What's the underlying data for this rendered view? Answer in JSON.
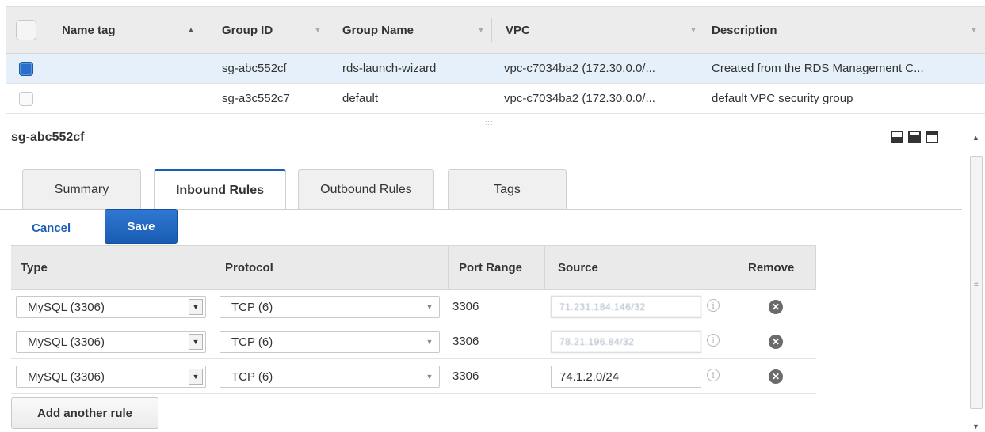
{
  "sg_table": {
    "columns": [
      "Name tag",
      "Group ID",
      "Group Name",
      "VPC",
      "Description"
    ],
    "rows": [
      {
        "selected": true,
        "name_tag": "",
        "group_id": "sg-abc552cf",
        "group_name": "rds-launch-wizard",
        "vpc": "vpc-c7034ba2 (172.30.0.0/...",
        "description": "Created from the RDS Management C..."
      },
      {
        "selected": false,
        "name_tag": "",
        "group_id": "sg-a3c552c7",
        "group_name": "default",
        "vpc": "vpc-c7034ba2 (172.30.0.0/...",
        "description": "default VPC security group"
      }
    ]
  },
  "detail": {
    "title": "sg-abc552cf",
    "tabs": [
      "Summary",
      "Inbound Rules",
      "Outbound Rules",
      "Tags"
    ],
    "active_tab": "Inbound Rules",
    "cancel_label": "Cancel",
    "save_label": "Save",
    "rules_columns": [
      "Type",
      "Protocol",
      "Port Range",
      "Source",
      "Remove"
    ],
    "rules": [
      {
        "type": "MySQL (3306)",
        "protocol": "TCP (6)",
        "port_range": "3306",
        "source": "71.231.184.146/32",
        "source_obscured": true
      },
      {
        "type": "MySQL (3306)",
        "protocol": "TCP (6)",
        "port_range": "3306",
        "source": "78.21.196.84/32",
        "source_obscured": true
      },
      {
        "type": "MySQL (3306)",
        "protocol": "TCP (6)",
        "port_range": "3306",
        "source": "74.1.2.0/24",
        "source_obscured": false
      }
    ],
    "add_rule_label": "Add another rule"
  },
  "colors": {
    "accent": "#1b5fb4",
    "selected_row": "#e6f0fa",
    "header_bg": "#ececec"
  },
  "icons": {
    "sort_asc": "caret-up-icon",
    "sort": "caret-down-icon",
    "info": "info-icon",
    "remove": "remove-circle-x-icon",
    "select_arrow": "dropdown-arrow-icon"
  }
}
